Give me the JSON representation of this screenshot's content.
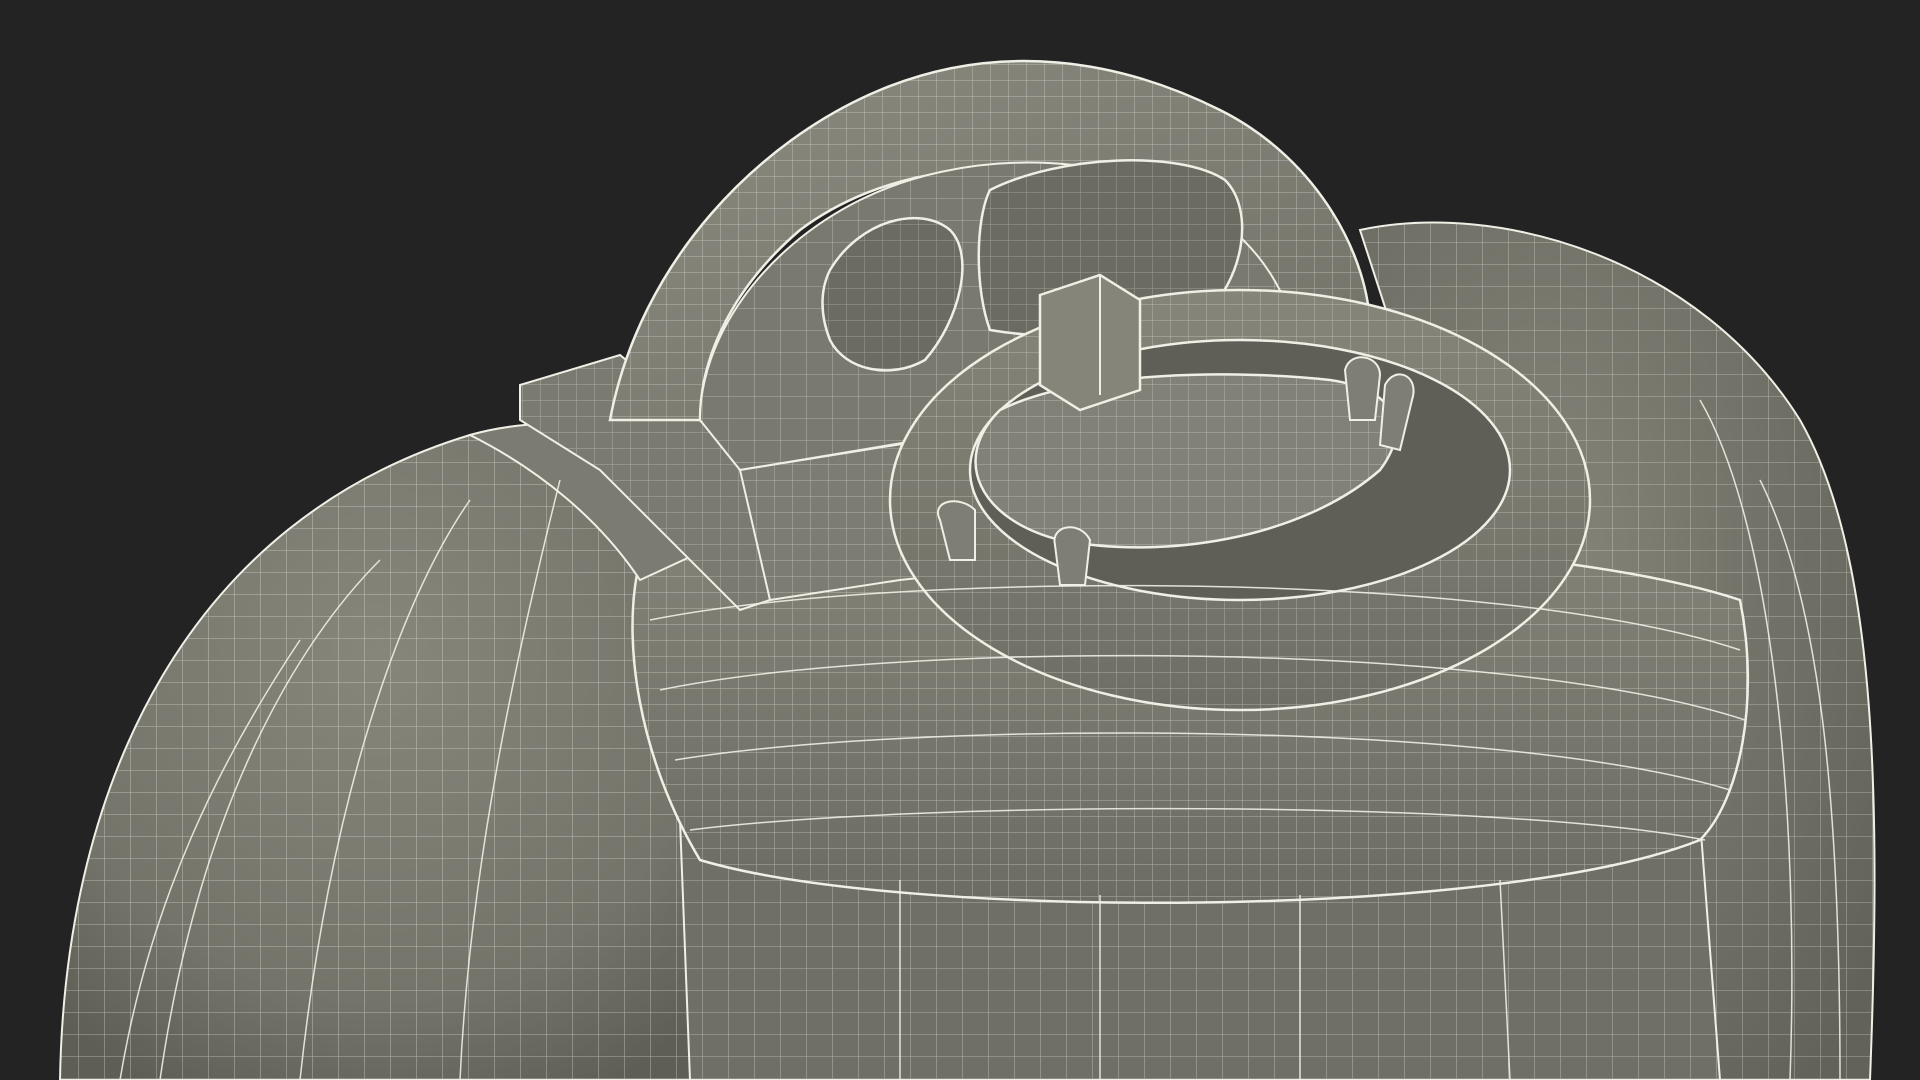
{
  "scene": {
    "background_color": "#232323",
    "surface_color": "#7e7e74",
    "surface_dark_color": "#6d6d64",
    "wire_color": "#f2f2ea",
    "subject": "wireframe-render-of-tank-sprayer-top"
  }
}
